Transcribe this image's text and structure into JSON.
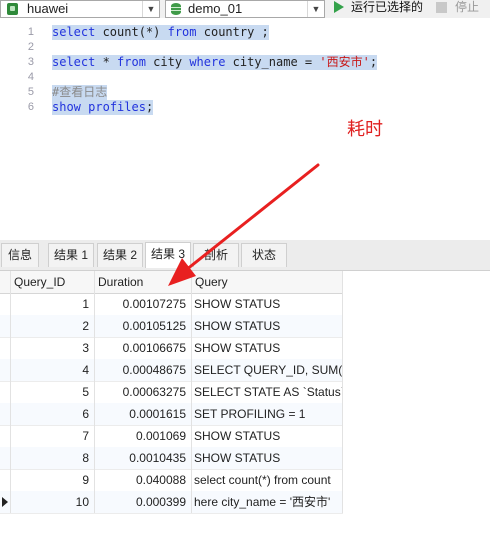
{
  "toolbar": {
    "connection": "huawei",
    "database": "demo_01",
    "run_selected_label": "运行已选择的",
    "stop_label": "停止"
  },
  "editor": {
    "lines": [
      {
        "num": "1",
        "tokens": [
          {
            "t": "kw",
            "v": "select"
          },
          {
            "t": "id",
            "v": " count(*) "
          },
          {
            "t": "kw",
            "v": "from"
          },
          {
            "t": "id",
            "v": " country ;"
          }
        ]
      },
      {
        "num": "2",
        "tokens": []
      },
      {
        "num": "3",
        "tokens": [
          {
            "t": "kw",
            "v": "select"
          },
          {
            "t": "id",
            "v": " * "
          },
          {
            "t": "kw",
            "v": "from"
          },
          {
            "t": "id",
            "v": " city "
          },
          {
            "t": "kw",
            "v": "where"
          },
          {
            "t": "id",
            "v": " city_name = "
          },
          {
            "t": "str",
            "v": "'西安市'"
          },
          {
            "t": "id",
            "v": ";"
          }
        ]
      },
      {
        "num": "4",
        "tokens": []
      },
      {
        "num": "5",
        "tokens": [
          {
            "t": "cmt",
            "v": "#查看日志"
          }
        ]
      },
      {
        "num": "6",
        "tokens": [
          {
            "t": "kw",
            "v": "show"
          },
          {
            "t": "id",
            "v": " "
          },
          {
            "t": "kw",
            "v": "profiles"
          },
          {
            "t": "id",
            "v": ";"
          }
        ]
      }
    ]
  },
  "annotation": {
    "text": "耗时",
    "color": "#e02020"
  },
  "tabs": [
    {
      "label": "信息"
    },
    {
      "label": "结果 1"
    },
    {
      "label": "结果 2"
    },
    {
      "label": "结果 3"
    },
    {
      "label": "剖析"
    },
    {
      "label": "状态"
    }
  ],
  "active_tab": "结果 3",
  "grid": {
    "columns": [
      "Query_ID",
      "Duration",
      "Query"
    ],
    "rows": [
      {
        "id": "1",
        "duration": "0.00107275",
        "query": "SHOW STATUS"
      },
      {
        "id": "2",
        "duration": "0.00105125",
        "query": "SHOW STATUS"
      },
      {
        "id": "3",
        "duration": "0.00106675",
        "query": "SHOW STATUS"
      },
      {
        "id": "4",
        "duration": "0.00048675",
        "query": "SELECT QUERY_ID, SUM(D"
      },
      {
        "id": "5",
        "duration": "0.00063275",
        "query": "SELECT STATE AS `Status`"
      },
      {
        "id": "6",
        "duration": "0.0001615",
        "query": "SET PROFILING = 1"
      },
      {
        "id": "7",
        "duration": "0.001069",
        "query": "SHOW STATUS"
      },
      {
        "id": "8",
        "duration": "0.0010435",
        "query": "SHOW STATUS"
      },
      {
        "id": "9",
        "duration": "0.040088",
        "query": "select count(*) from count"
      },
      {
        "id": "10",
        "duration": "0.000399",
        "query": "here city_name = '西安市'"
      }
    ]
  },
  "colors": {
    "keyword": "#2233dd",
    "string": "#c81818",
    "selection": "#c8daf1",
    "run_icon": "#33a14a"
  }
}
